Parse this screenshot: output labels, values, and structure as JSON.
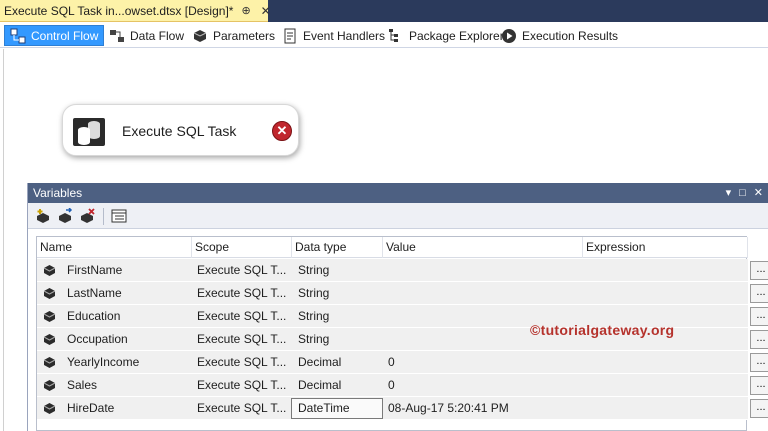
{
  "document_tab": {
    "title": "Execute SQL Task in...owset.dtsx [Design]*",
    "pin_glyph": "⊕",
    "close_glyph": "✕"
  },
  "designer_tabs": [
    {
      "label": "Control Flow",
      "icon": "control-flow-icon",
      "active": true
    },
    {
      "label": "Data Flow",
      "icon": "data-flow-icon",
      "active": false
    },
    {
      "label": "Parameters",
      "icon": "parameters-icon",
      "active": false
    },
    {
      "label": "Event Handlers",
      "icon": "event-handlers-icon",
      "active": false
    },
    {
      "label": "Package Explorer",
      "icon": "package-explorer-icon",
      "active": false
    },
    {
      "label": "Execution Results",
      "icon": "execution-results-icon",
      "active": false
    }
  ],
  "task": {
    "label": "Execute SQL Task",
    "icon": "execute-sql-task-icon",
    "status_icon": "error-icon",
    "status_glyph": "✕"
  },
  "variables_window": {
    "title": "Variables",
    "columns": [
      "Name",
      "Scope",
      "Data type",
      "Value",
      "Expression"
    ],
    "rows": [
      {
        "name": "FirstName",
        "scope": "Execute SQL T...",
        "data_type": "String",
        "value": "",
        "expression": ""
      },
      {
        "name": "LastName",
        "scope": "Execute SQL T...",
        "data_type": "String",
        "value": "",
        "expression": ""
      },
      {
        "name": "Education",
        "scope": "Execute SQL T...",
        "data_type": "String",
        "value": "",
        "expression": ""
      },
      {
        "name": "Occupation",
        "scope": "Execute SQL T...",
        "data_type": "String",
        "value": "",
        "expression": ""
      },
      {
        "name": "YearlyIncome",
        "scope": "Execute SQL T...",
        "data_type": "Decimal",
        "value": "0",
        "expression": ""
      },
      {
        "name": "Sales",
        "scope": "Execute SQL T...",
        "data_type": "Decimal",
        "value": "0",
        "expression": ""
      },
      {
        "name": "HireDate",
        "scope": "Execute SQL T...",
        "data_type": "DateTime",
        "value": "08-Aug-17 5:20:41 PM",
        "expression": ""
      }
    ],
    "ellipsis_label": "...",
    "window_buttons": {
      "dropdown": "▾",
      "maximize": "□",
      "close": "✕"
    }
  },
  "watermark": "©tutorialgateway.org"
}
